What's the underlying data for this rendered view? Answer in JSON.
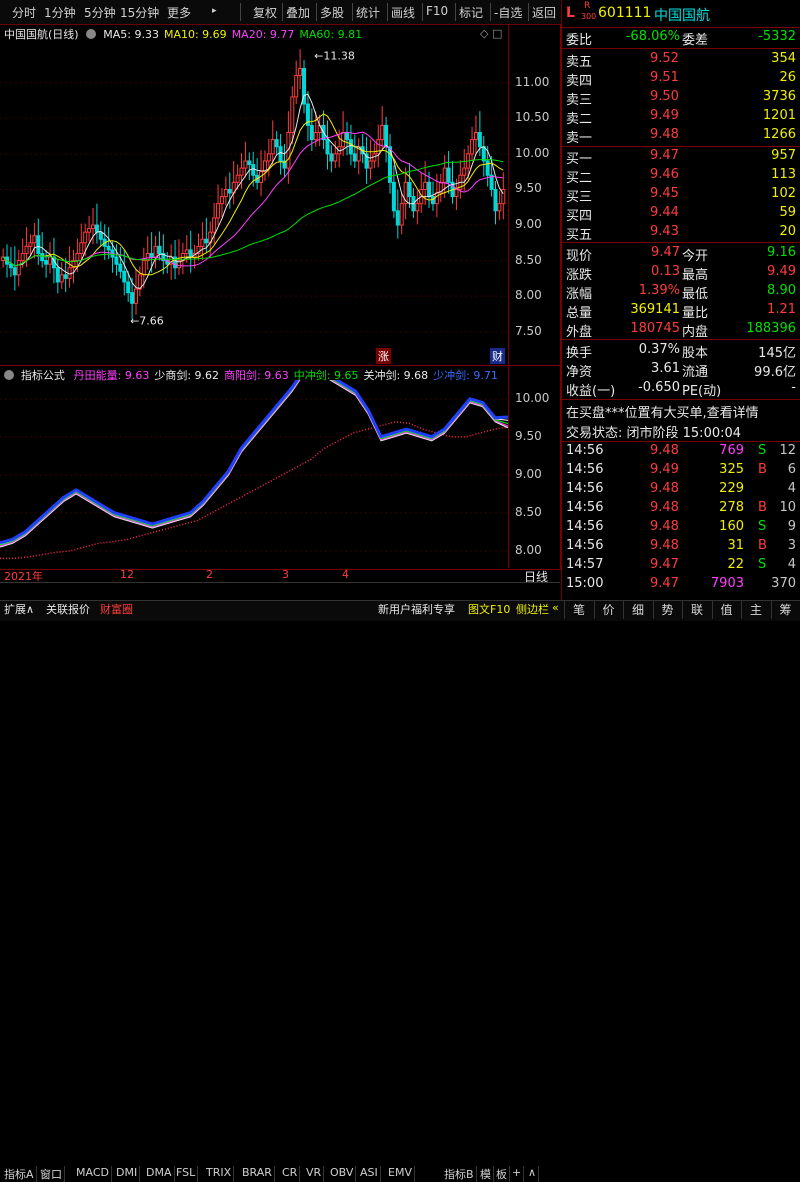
{
  "toolbar": {
    "periods": [
      "分时",
      "1分钟",
      "5分钟",
      "15分钟",
      "更多"
    ],
    "more_arrow": "▸",
    "actions": [
      "复权",
      "叠加",
      "多股",
      "统计",
      "画线",
      "F10",
      "标记",
      "-自选",
      "返回"
    ]
  },
  "main_chart": {
    "title": "中国国航(日线)",
    "ma_labels": [
      {
        "text": "MA5: 9.33",
        "color": "#e8e8e8"
      },
      {
        "text": "MA10: 9.69",
        "color": "#f0f000"
      },
      {
        "text": "MA20: 9.77",
        "color": "#ff40ff"
      },
      {
        "text": "MA60: 9.81",
        "color": "#00e000"
      }
    ],
    "high_marker": "11.38",
    "low_marker": "7.66",
    "y_ticks": [
      "11.00",
      "10.50",
      "10.00",
      "9.50",
      "9.00",
      "8.50",
      "8.00",
      "7.50"
    ],
    "badge_rise": "涨",
    "badge_fin": "财"
  },
  "indicator_chart": {
    "title": "指标公式",
    "labels": [
      {
        "text": "丹田能量: 9.63",
        "color": "#ff40ff"
      },
      {
        "text": "少商剑: 9.62",
        "color": "#e8e8e8"
      },
      {
        "text": "商阳剑: 9.63",
        "color": "#ff40ff"
      },
      {
        "text": "中冲剑: 9.65",
        "color": "#00e000"
      },
      {
        "text": "关冲剑: 9.68",
        "color": "#e8e8e8"
      },
      {
        "text": "少冲剑: 9.71",
        "color": "#3a6bff"
      }
    ],
    "y_ticks": [
      "10.00",
      "9.50",
      "9.00",
      "8.50",
      "8.00"
    ]
  },
  "x_axis": {
    "labels": [
      "2021年",
      "12",
      "2",
      "3",
      "4"
    ],
    "period_label": "日线"
  },
  "bottom_tabs": [
    "指标A",
    "窗口",
    "MACD",
    "DMI",
    "DMA",
    "FSL",
    "TRIX",
    "BRAR",
    "CR",
    "VR",
    "OBV",
    "ASI",
    "EMV",
    "指标B",
    "模",
    "板",
    "+",
    "∧"
  ],
  "bottom_bar": {
    "expand": "扩展∧",
    "linked": "关联报价",
    "wealth": "财富圈",
    "promo": "新用户福利专享",
    "f10": "图文F10",
    "sidebar": "侧边栏",
    "sidebar_arrow": "«"
  },
  "quote": {
    "market_badge": "L",
    "r_badge": "R",
    "r_sub": "300",
    "code": "601111",
    "name": "中国国航",
    "weibi_label": "委比",
    "weibi": "-68.06%",
    "weicha_label": "委差",
    "weicha": "-5332",
    "asks": [
      {
        "label": "卖五",
        "price": "9.52",
        "vol": "354"
      },
      {
        "label": "卖四",
        "price": "9.51",
        "vol": "26"
      },
      {
        "label": "卖三",
        "price": "9.50",
        "vol": "3736"
      },
      {
        "label": "卖二",
        "price": "9.49",
        "vol": "1201"
      },
      {
        "label": "卖一",
        "price": "9.48",
        "vol": "1266"
      }
    ],
    "bids": [
      {
        "label": "买一",
        "price": "9.47",
        "vol": "957"
      },
      {
        "label": "买二",
        "price": "9.46",
        "vol": "113"
      },
      {
        "label": "买三",
        "price": "9.45",
        "vol": "102"
      },
      {
        "label": "买四",
        "price": "9.44",
        "vol": "59"
      },
      {
        "label": "买五",
        "price": "9.43",
        "vol": "20"
      }
    ],
    "stats": [
      {
        "l1": "现价",
        "v1": "9.47",
        "c1": "#ff3c3c",
        "l2": "今开",
        "v2": "9.16",
        "c2": "#00e000"
      },
      {
        "l1": "涨跌",
        "v1": "0.13",
        "c1": "#ff3c3c",
        "l2": "最高",
        "v2": "9.49",
        "c2": "#ff3c3c"
      },
      {
        "l1": "涨幅",
        "v1": "1.39%",
        "c1": "#ff3c3c",
        "l2": "最低",
        "v2": "8.90",
        "c2": "#00e000"
      },
      {
        "l1": "总量",
        "v1": "369141",
        "c1": "#f0f000",
        "l2": "量比",
        "v2": "1.21",
        "c2": "#ff3c3c"
      },
      {
        "l1": "外盘",
        "v1": "180745",
        "c1": "#ff3c3c",
        "l2": "内盘",
        "v2": "188396",
        "c2": "#00e000"
      }
    ],
    "stats2": [
      {
        "l1": "换手",
        "v1": "0.37%",
        "l2": "股本",
        "v2": "145亿"
      },
      {
        "l1": "净资",
        "v1": "3.61",
        "l2": "流通",
        "v2": "99.6亿"
      },
      {
        "l1": "收益(一)",
        "v1": "-0.650",
        "l2": "PE(动)",
        "v2": "-"
      }
    ],
    "notice": "在买盘***位置有大买单,查看详情",
    "status": "交易状态: 闭市阶段 15:00:04",
    "trades": [
      {
        "time": "14:56",
        "price": "9.48",
        "vol": "769",
        "side": "S",
        "extra": "12",
        "vc": "#ff40ff",
        "sc": "#00e000"
      },
      {
        "time": "14:56",
        "price": "9.49",
        "vol": "325",
        "side": "B",
        "extra": "6",
        "vc": "#f0f000",
        "sc": "#ff3c3c"
      },
      {
        "time": "14:56",
        "price": "9.48",
        "vol": "229",
        "side": "",
        "extra": "4",
        "vc": "#f0f000",
        "sc": "#ff3c3c"
      },
      {
        "time": "14:56",
        "price": "9.48",
        "vol": "278",
        "side": "B",
        "extra": "10",
        "vc": "#f0f000",
        "sc": "#ff3c3c"
      },
      {
        "time": "14:56",
        "price": "9.48",
        "vol": "160",
        "side": "S",
        "extra": "9",
        "vc": "#f0f000",
        "sc": "#00e000"
      },
      {
        "time": "14:56",
        "price": "9.48",
        "vol": "31",
        "side": "B",
        "extra": "3",
        "vc": "#f0f000",
        "sc": "#ff3c3c"
      },
      {
        "time": "14:57",
        "price": "9.47",
        "vol": "22",
        "side": "S",
        "extra": "4",
        "vc": "#f0f000",
        "sc": "#00e000"
      },
      {
        "time": "15:00",
        "price": "9.47",
        "vol": "7903",
        "side": "",
        "extra": "370",
        "vc": "#ff40ff",
        "sc": "#ff3c3c"
      }
    ],
    "nav": [
      "笔",
      "价",
      "细",
      "势",
      "联",
      "值",
      "主",
      "筹"
    ]
  },
  "chart_data": [
    {
      "type": "candlestick",
      "title": "中国国航(日线)",
      "x_labels": [
        "2021年",
        "12",
        "2",
        "3",
        "4"
      ],
      "ylim": [
        7.3,
        11.6
      ],
      "close": [
        8.55,
        8.45,
        8.4,
        8.3,
        8.5,
        8.6,
        8.7,
        8.75,
        8.85,
        8.6,
        8.5,
        8.45,
        8.55,
        8.4,
        8.2,
        8.3,
        8.25,
        8.4,
        8.5,
        8.6,
        8.75,
        8.9,
        8.95,
        9.0,
        8.9,
        8.8,
        8.7,
        8.65,
        8.55,
        8.45,
        8.35,
        8.2,
        8.05,
        7.9,
        8.1,
        8.3,
        8.5,
        8.6,
        8.55,
        8.7,
        8.6,
        8.5,
        8.45,
        8.55,
        8.4,
        8.5,
        8.6,
        8.65,
        8.55,
        8.6,
        8.7,
        8.8,
        8.75,
        8.9,
        9.1,
        9.3,
        9.4,
        9.5,
        9.45,
        9.6,
        9.7,
        9.8,
        9.9,
        9.85,
        9.7,
        9.6,
        9.75,
        9.9,
        10.0,
        10.2,
        10.1,
        9.9,
        9.8,
        10.3,
        10.8,
        11.1,
        11.2,
        10.7,
        10.4,
        10.2,
        10.3,
        10.4,
        10.2,
        10.0,
        9.9,
        10.0,
        10.1,
        10.3,
        10.2,
        10.0,
        9.9,
        10.1,
        10.0,
        9.8,
        9.9,
        10.0,
        10.2,
        10.4,
        10.1,
        9.6,
        9.2,
        9.0,
        9.3,
        9.6,
        9.4,
        9.2,
        9.3,
        9.5,
        9.6,
        9.4,
        9.3,
        9.45,
        9.6,
        9.8,
        9.6,
        9.4,
        9.5,
        9.7,
        9.8,
        10.0,
        10.2,
        10.3,
        10.1,
        9.9,
        9.7,
        9.5,
        9.2,
        9.3,
        9.5
      ],
      "ma5": 9.33,
      "ma10": 9.69,
      "ma20": 9.77,
      "ma60": 9.81,
      "high": 11.38,
      "low": 7.66
    },
    {
      "type": "line",
      "title": "指标公式",
      "ylim": [
        7.8,
        10.25
      ],
      "series": [
        {
          "name": "丹田能量",
          "values": [
            7.9,
            7.9,
            7.92,
            7.95,
            7.98,
            8.0,
            8.05,
            8.1,
            8.12,
            8.15,
            8.2,
            8.25,
            8.3,
            8.35,
            8.4,
            8.5,
            8.6,
            8.7,
            8.8,
            8.9,
            9.0,
            9.1,
            9.2,
            9.35,
            9.45,
            9.55,
            9.6,
            9.65,
            9.7,
            9.68,
            9.6,
            9.55,
            9.5,
            9.5,
            9.55,
            9.6,
            9.63
          ]
        },
        {
          "name": "少商剑",
          "values": [
            8.05,
            8.1,
            8.2,
            8.35,
            8.5,
            8.65,
            8.75,
            8.65,
            8.55,
            8.45,
            8.4,
            8.35,
            8.3,
            8.35,
            8.4,
            8.45,
            8.6,
            8.8,
            9.0,
            9.3,
            9.5,
            9.7,
            9.9,
            10.1,
            10.35,
            10.35,
            10.25,
            10.15,
            10.05,
            9.8,
            9.45,
            9.5,
            9.55,
            9.5,
            9.45,
            9.55,
            9.75,
            9.95,
            9.9,
            9.7,
            9.62
          ]
        },
        {
          "name": "商阳剑",
          "values": [
            8.05,
            8.1,
            8.2,
            8.35,
            8.5,
            8.65,
            8.75,
            8.65,
            8.55,
            8.45,
            8.4,
            8.35,
            8.3,
            8.35,
            8.4,
            8.45,
            8.6,
            8.8,
            9.0,
            9.3,
            9.5,
            9.7,
            9.9,
            10.1,
            10.35,
            10.35,
            10.25,
            10.15,
            10.05,
            9.8,
            9.45,
            9.5,
            9.55,
            9.5,
            9.45,
            9.55,
            9.75,
            9.95,
            9.9,
            9.7,
            9.63
          ]
        },
        {
          "name": "中冲剑",
          "values": [
            8.05,
            8.1,
            8.2,
            8.35,
            8.5,
            8.65,
            8.75,
            8.65,
            8.55,
            8.45,
            8.4,
            8.35,
            8.3,
            8.35,
            8.4,
            8.45,
            8.6,
            8.8,
            9.0,
            9.3,
            9.5,
            9.7,
            9.9,
            10.1,
            10.35,
            10.35,
            10.25,
            10.15,
            10.05,
            9.8,
            9.45,
            9.5,
            9.55,
            9.5,
            9.45,
            9.55,
            9.75,
            9.95,
            9.9,
            9.7,
            9.65
          ]
        },
        {
          "name": "关冲剑",
          "values": [
            8.05,
            8.1,
            8.2,
            8.35,
            8.5,
            8.65,
            8.75,
            8.65,
            8.55,
            8.45,
            8.4,
            8.35,
            8.3,
            8.35,
            8.4,
            8.45,
            8.6,
            8.8,
            9.0,
            9.3,
            9.5,
            9.7,
            9.9,
            10.1,
            10.35,
            10.35,
            10.25,
            10.15,
            10.05,
            9.8,
            9.45,
            9.5,
            9.55,
            9.5,
            9.45,
            9.55,
            9.75,
            9.95,
            9.9,
            9.7,
            9.68
          ]
        },
        {
          "name": "少冲剑",
          "values": [
            8.05,
            8.1,
            8.2,
            8.35,
            8.5,
            8.65,
            8.75,
            8.65,
            8.55,
            8.45,
            8.4,
            8.35,
            8.3,
            8.35,
            8.4,
            8.45,
            8.6,
            8.8,
            9.0,
            9.3,
            9.5,
            9.7,
            9.9,
            10.1,
            10.35,
            10.35,
            10.25,
            10.15,
            10.05,
            9.8,
            9.45,
            9.5,
            9.55,
            9.5,
            9.45,
            9.55,
            9.75,
            9.95,
            9.9,
            9.7,
            9.71
          ]
        }
      ]
    }
  ]
}
